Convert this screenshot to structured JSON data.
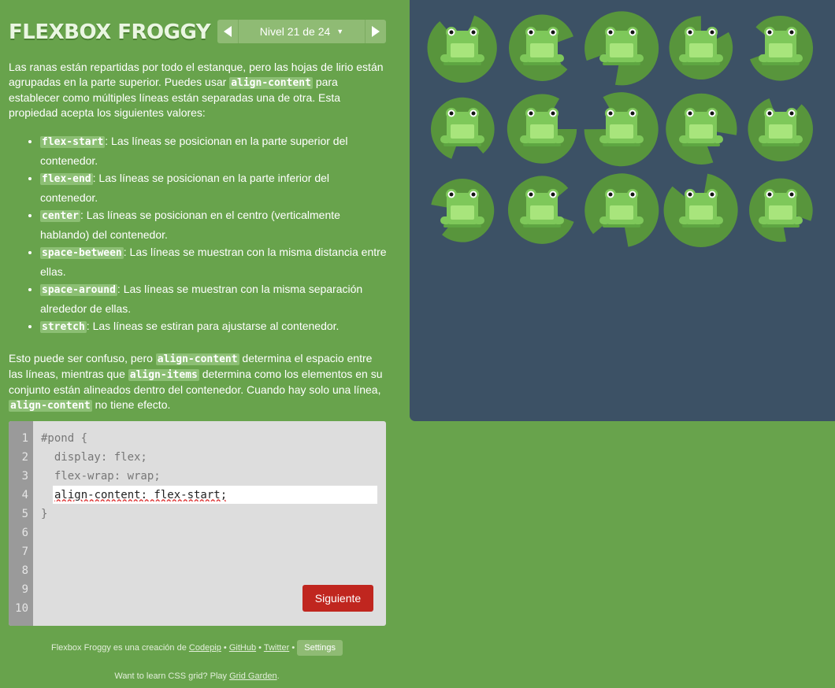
{
  "app": {
    "title": "FLEXBOX FROGGY"
  },
  "level_nav": {
    "label": "Nivel 21 de 24",
    "prev_icon": "chevron-left-icon",
    "next_icon": "chevron-right-icon",
    "dropdown_icon": "caret-down-icon"
  },
  "instructions": {
    "intro_1": "Las ranas están repartidas por todo el estanque, pero las hojas de lirio están agrupadas en la parte superior. Puedes usar ",
    "intro_code": "align-content",
    "intro_2": " para establecer como múltiples líneas están separadas una de otra. Esta propiedad acepta los siguientes valores:",
    "values": [
      {
        "code": "flex-start",
        "text": ": Las líneas se posicionan en la parte superior del contenedor."
      },
      {
        "code": "flex-end",
        "text": ": Las líneas se posicionan en la parte inferior del contenedor."
      },
      {
        "code": "center",
        "text": ": Las líneas se posicionan en el centro (verticalmente hablando) del contenedor."
      },
      {
        "code": "space-between",
        "text": ": Las líneas se muestran con la misma distancia entre ellas."
      },
      {
        "code": "space-around",
        "text": ": Las líneas se muestran con la misma separación alrededor de ellas."
      },
      {
        "code": "stretch",
        "text": ": Las líneas se estiran para ajustarse al contenedor."
      }
    ],
    "outro_1": "Esto puede ser confuso, pero ",
    "outro_code_1": "align-content",
    "outro_2": " determina el espacio entre las líneas, mientras que ",
    "outro_code_2": "align-items",
    "outro_3": " determina como los elementos en su conjunto están alineados dentro del contenedor. Cuando hay solo una línea, ",
    "outro_code_3": "align-content",
    "outro_4": " no tiene efecto."
  },
  "editor": {
    "line_numbers": [
      "1",
      "2",
      "3",
      "4",
      "5",
      "6",
      "7",
      "8",
      "9",
      "10"
    ],
    "line_1": "#pond {",
    "line_2": "  display: flex;",
    "line_3": "  flex-wrap: wrap;",
    "input_value": "align-content: flex-start;",
    "line_5": "}",
    "next_button": "Siguiente"
  },
  "footer": {
    "credit_prefix": "Flexbox Froggy es una creación de ",
    "codepip": "Codepip",
    "sep": " • ",
    "github": "GitHub",
    "twitter": "Twitter",
    "settings": "Settings",
    "promo_prefix": "Want to learn CSS grid? Play ",
    "grid_garden": "Grid Garden",
    "promo_suffix": "."
  },
  "pond": {
    "rows": 3,
    "per_row": 5,
    "frog_color": "green"
  },
  "colors": {
    "background": "#68a34c",
    "pond": "#3c5165",
    "lilypad": "#58953c",
    "frog": "#a8e57c",
    "next_button": "#c0261f"
  }
}
